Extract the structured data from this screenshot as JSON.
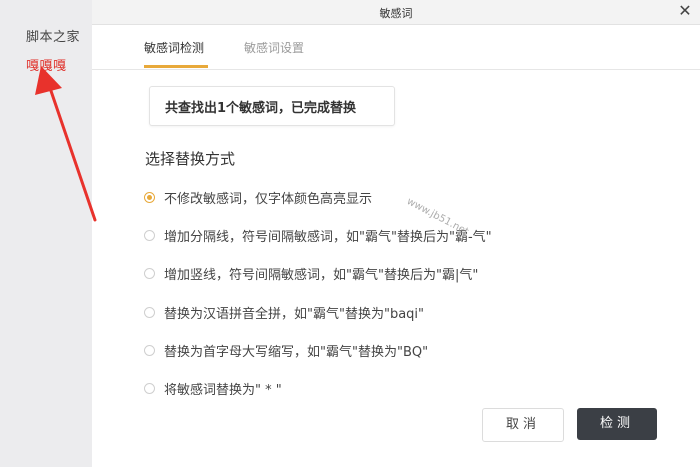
{
  "background_doc": {
    "line1": "脚本之家",
    "line2": "嘎嘎嘎"
  },
  "dialog": {
    "title": "敏感词",
    "close_glyph": "✕",
    "tabs": [
      {
        "label": "敏感词检测"
      },
      {
        "label": "敏感词设置"
      }
    ],
    "result_text": "共查找出1个敏感词，已完成替换",
    "section_title": "选择替换方式",
    "options": [
      {
        "label": "不修改敏感词，仅字体颜色高亮显示"
      },
      {
        "label": "增加分隔线，符号间隔敏感词，如\"霸气\"替换后为\"霸-气\""
      },
      {
        "label": "增加竖线，符号间隔敏感词，如\"霸气\"替换后为\"霸|气\""
      },
      {
        "label": "替换为汉语拼音全拼，如\"霸气\"替换为\"baqi\""
      },
      {
        "label": "替换为首字母大写缩写，如\"霸气\"替换为\"BQ\""
      },
      {
        "label": "将敏感词替换为\" * \""
      }
    ],
    "selected_option": 0,
    "cancel_label": "取消",
    "detect_label": "检测"
  },
  "watermark": "www.jb51.net",
  "colors": {
    "accent": "#e8a93a",
    "red_text": "#e0302a",
    "arrow": "#e8322c",
    "primary_button": "#3b3f45"
  }
}
